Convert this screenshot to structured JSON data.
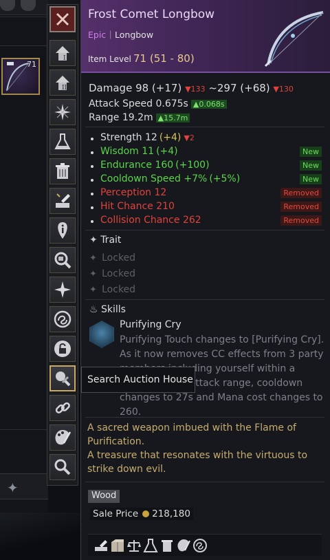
{
  "item": {
    "name": "Frost Comet Longbow",
    "rarity": "Epic",
    "separator": "|",
    "type": "Longbow",
    "level_label": "Item Level",
    "level_value": "71 (51 - 80)",
    "background_slot_level": "71"
  },
  "stats": {
    "damage_label": "Damage 98 (+17)",
    "damage_min_change": "133",
    "damage_max": "~297 (+68)",
    "damage_max_change": "130",
    "attack_speed": "Attack Speed 0.675s",
    "attack_speed_change": "0.068s",
    "range": "Range 19.2m",
    "range_change": "15.7m"
  },
  "attributes": [
    {
      "name": "Strength 12",
      "bonus": "(+4)",
      "change": "2",
      "status": "",
      "color": "#dcdcdc"
    },
    {
      "name": "Wisdom 11",
      "bonus": "(+4)",
      "change": "",
      "status": "New",
      "color": "#5bd54a"
    },
    {
      "name": "Endurance 160",
      "bonus": "(+100)",
      "change": "",
      "status": "New",
      "color": "#5bd54a"
    },
    {
      "name": "Cooldown Speed +7%",
      "bonus": "(+5%)",
      "change": "",
      "status": "New",
      "color": "#5bd54a"
    },
    {
      "name": "Perception 12",
      "bonus": "",
      "change": "",
      "status": "Removed",
      "color": "#e0433d"
    },
    {
      "name": "Hit Chance 210",
      "bonus": "",
      "change": "",
      "status": "Removed",
      "color": "#e0433d"
    },
    {
      "name": "Collision Chance 262",
      "bonus": "",
      "change": "",
      "status": "Removed",
      "color": "#e0433d"
    }
  ],
  "trait": {
    "title": "Trait",
    "slots": [
      "Locked",
      "Locked",
      "Locked"
    ]
  },
  "skills": {
    "title": "Skills",
    "name": "Purifying Cry",
    "description": "Purifying Touch changes to [Purifying Cry]. As it now removes CC effects from 3 party members including yourself within a radius of your attack range, cooldown changes to 27s and Mana cost changes to 260."
  },
  "flavor": [
    "A sacred weapon imbued with the Flame of Purification.",
    "A treasure that resonates with the virtuous to strike down evil."
  ],
  "material": "Wood",
  "sale": {
    "label": "Sale Price",
    "value": "218,180"
  },
  "tooltip": "Search Auction House",
  "toolbar": [
    {
      "name": "close-button",
      "icon": "close-icon"
    },
    {
      "name": "equip-slot-1-button",
      "icon": "equip-1-icon"
    },
    {
      "name": "equip-slot-2-button",
      "icon": "equip-2-icon"
    },
    {
      "name": "enhance-button",
      "icon": "star-burst-icon"
    },
    {
      "name": "alchemy-button",
      "icon": "flask-icon"
    },
    {
      "name": "discard-button",
      "icon": "trash-icon"
    },
    {
      "name": "craft-button",
      "icon": "hammer-anvil-icon"
    },
    {
      "name": "info-button",
      "icon": "info-icon"
    },
    {
      "name": "search-item-button",
      "icon": "magnify-item-icon"
    },
    {
      "name": "trait-button",
      "icon": "compass-star-icon"
    },
    {
      "name": "link-swirl-button",
      "icon": "swirl-icon"
    },
    {
      "name": "lock-button",
      "icon": "lock-icon"
    },
    {
      "name": "search-auction-house-button",
      "icon": "auction-search-icon"
    },
    {
      "name": "link-button",
      "icon": "chain-link-icon"
    },
    {
      "name": "dye-button",
      "icon": "palette-brush-icon"
    },
    {
      "name": "search-button",
      "icon": "search-icon"
    }
  ],
  "colors": {
    "epic": "#d17ef0",
    "positive": "#5bd54a",
    "negative": "#e0433d",
    "gold": "#c9a23c",
    "flavor": "#c7ad6f"
  }
}
